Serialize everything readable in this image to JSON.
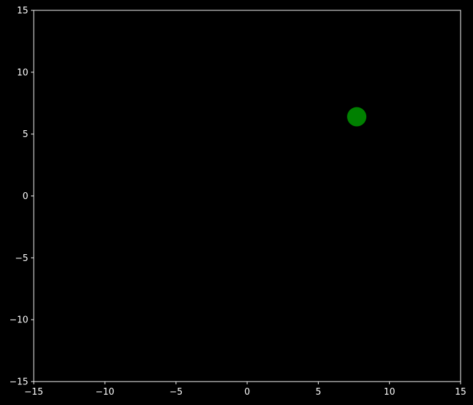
{
  "chart_data": {
    "type": "scatter",
    "title": "",
    "xlabel": "",
    "ylabel": "",
    "xlim": [
      -15,
      15
    ],
    "ylim": [
      -15,
      15
    ],
    "xticks": [
      -15,
      -10,
      -5,
      0,
      5,
      10,
      15
    ],
    "yticks": [
      -15,
      -10,
      -5,
      0,
      5,
      10,
      15
    ],
    "xtick_labels": [
      "−15",
      "−10",
      "−5",
      "0",
      "5",
      "10",
      "15"
    ],
    "ytick_labels": [
      "−15",
      "−10",
      "−5",
      "0",
      "5",
      "10",
      "15"
    ],
    "grid": false,
    "series": [
      {
        "points": [
          {
            "x": 7.7,
            "y": 6.4
          }
        ],
        "color": "#008000"
      }
    ],
    "background_color": "#000000",
    "axis_color": "#ffffff"
  }
}
